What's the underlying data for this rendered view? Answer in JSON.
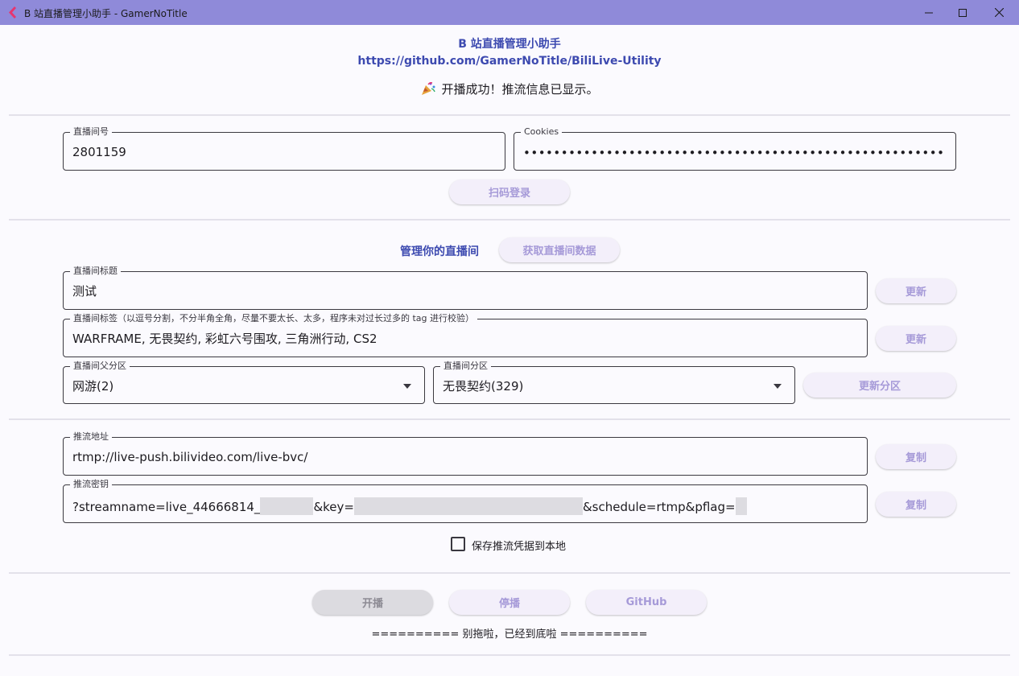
{
  "window": {
    "title": "B 站直播管理小助手 - GamerNoTitle"
  },
  "header": {
    "app_name": "B 站直播管理小助手",
    "repo_url": "https://github.com/GamerNoTitle/BiliLive-Utility",
    "status": "开播成功！推流信息已显示。"
  },
  "login": {
    "room_label": "直播间号",
    "room_value": "2801159",
    "cookies_label": "Cookies",
    "cookies_value": "••••••••••••••••••••••••••••••••••••••••••••••••••••••••••••••••••••",
    "qr_button": "扫码登录"
  },
  "manage": {
    "title": "管理你的直播间",
    "fetch_button": "获取直播间数据",
    "title_label": "直播间标题",
    "title_value": "测试",
    "title_update": "更新",
    "tags_label": "直播间标签（以逗号分割，不分半角全角，尽量不要太长、太多，程序未对过长过多的 tag 进行校验）",
    "tags_value": "WARFRAME, 无畏契约, 彩虹六号围攻, 三角洲行动, CS2",
    "tags_update": "更新",
    "parent_area_label": "直播间父分区",
    "parent_area_value": "网游(2)",
    "area_label": "直播间分区",
    "area_value": "无畏契约(329)",
    "area_update": "更新分区"
  },
  "stream": {
    "addr_label": "推流地址",
    "addr_value": "rtmp://live-push.bilivideo.com/live-bvc/",
    "addr_copy": "复制",
    "key_label": "推流密钥",
    "key_part1": "?streamname=live_44666814_",
    "key_part2": "&key=",
    "key_part3": "&schedule=rtmp&pflag=",
    "key_copy": "复制",
    "save_label": "保存推流凭据到本地"
  },
  "actions": {
    "start": "开播",
    "stop": "停播",
    "github": "GitHub"
  },
  "footer": {
    "text": "========== 别拖啦，已经到底啦 =========="
  },
  "colors": {
    "titlebar": "#8f8ad9",
    "accent": "#3d4ab0",
    "pill_bg": "#f3effa",
    "pill_text": "#a69ad8"
  }
}
